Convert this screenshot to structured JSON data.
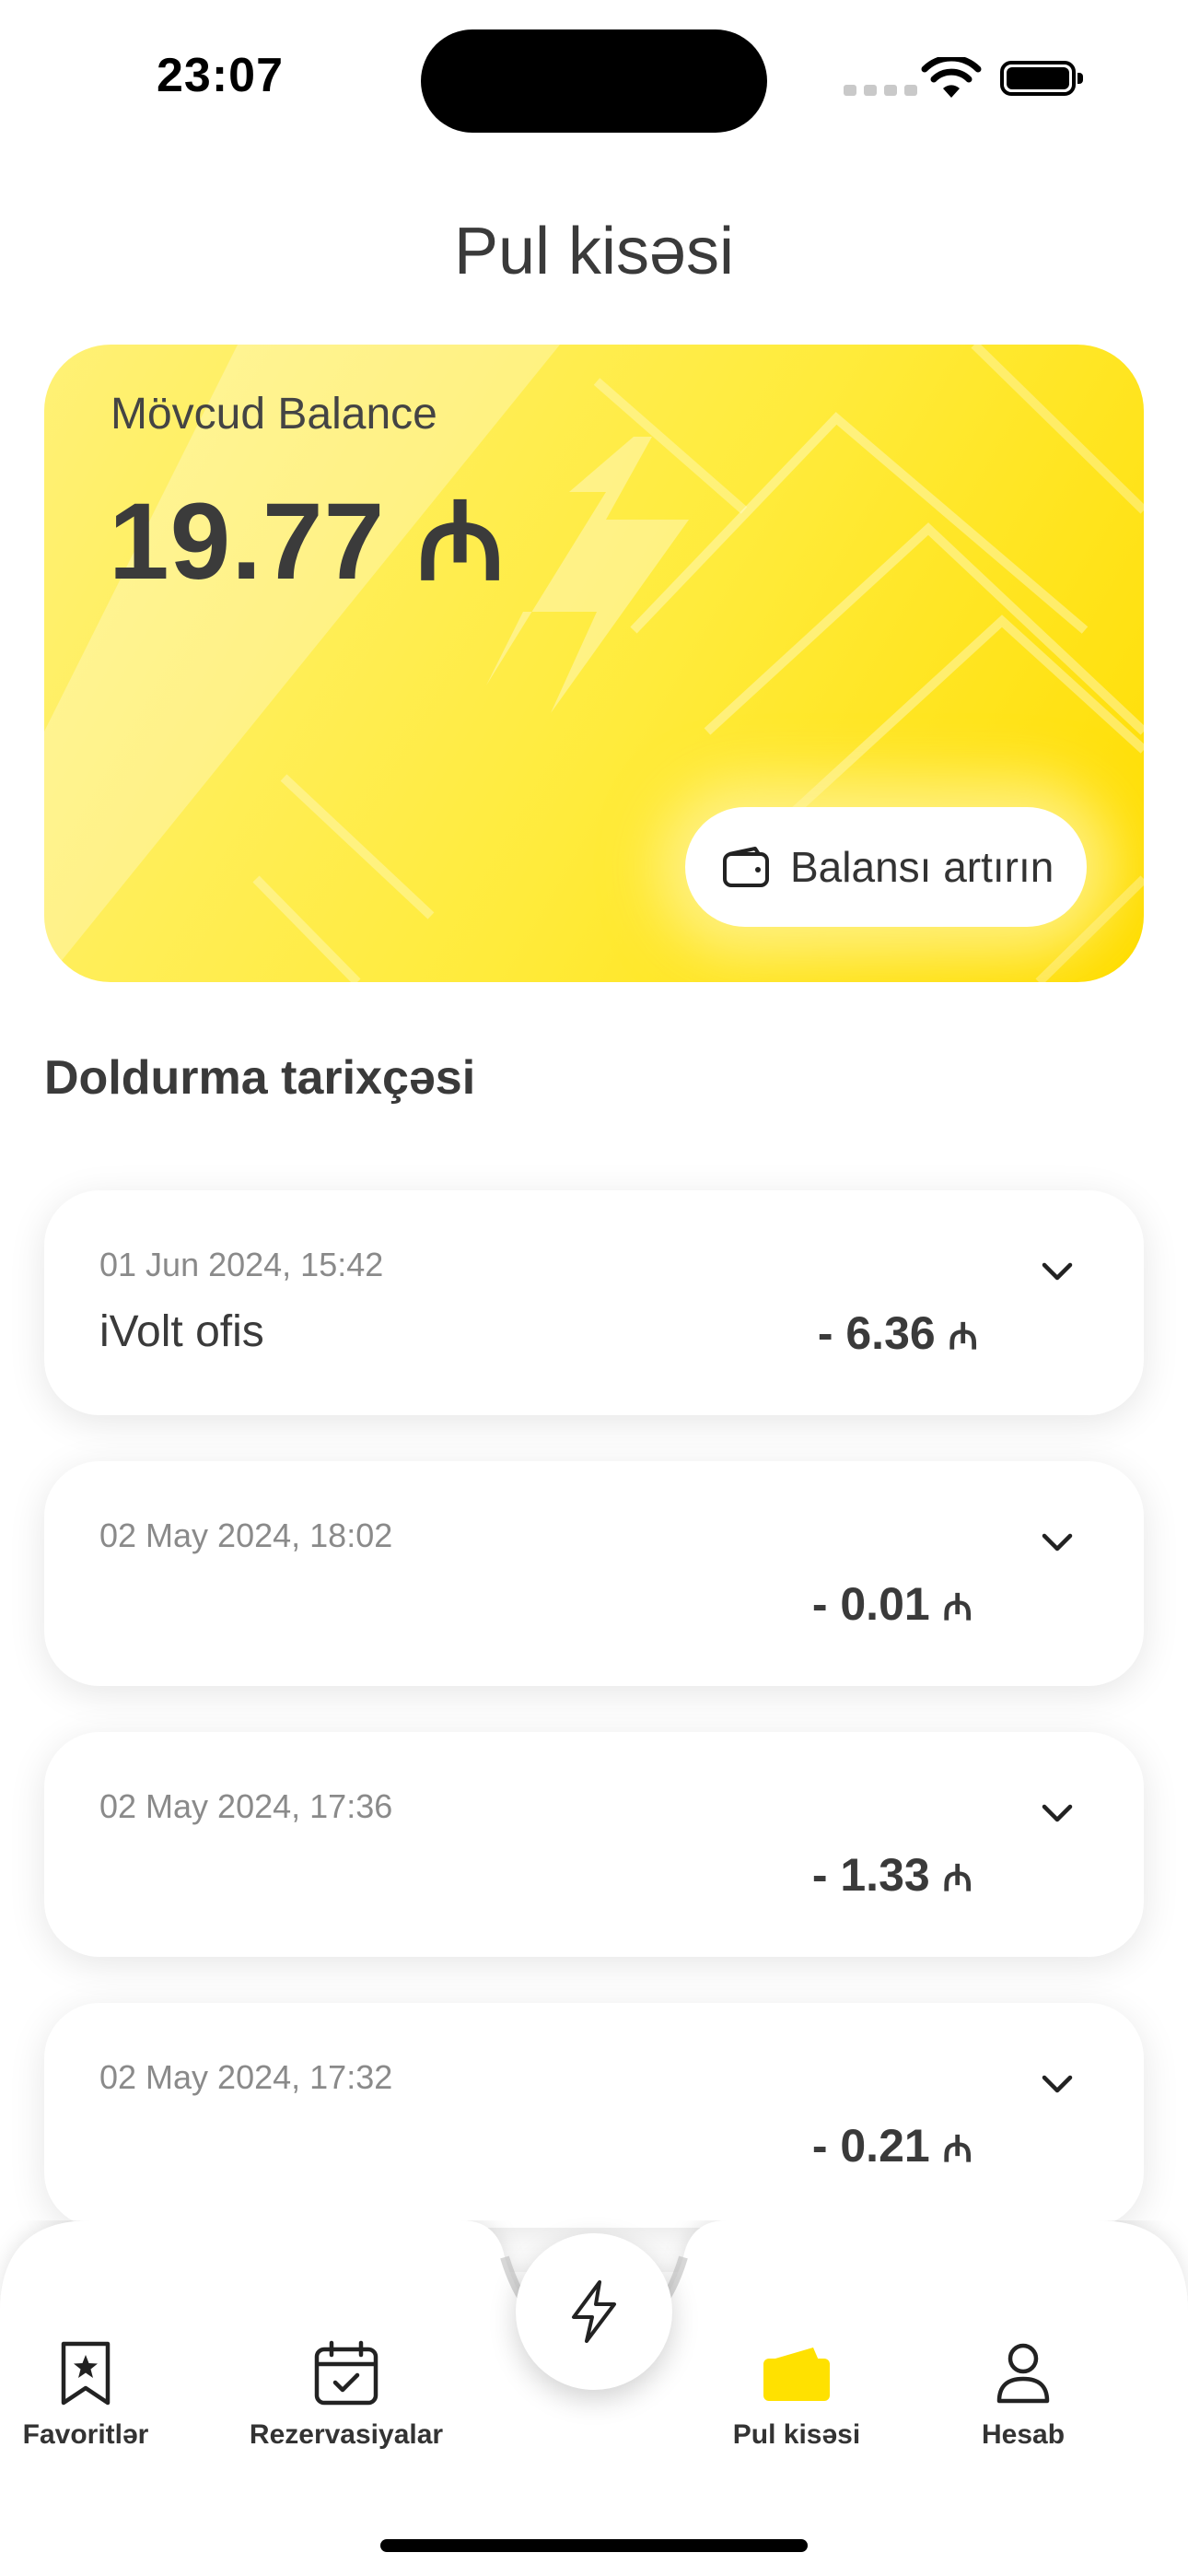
{
  "status_bar": {
    "time": "23:07"
  },
  "header": {
    "title": "Pul kisəsi"
  },
  "balance": {
    "label": "Mövcud Balance",
    "amount": "19.77 ₼",
    "topup_label": "Balansı artırın"
  },
  "history": {
    "title": "Doldurma tarixçəsi",
    "items": [
      {
        "date": "01 Jun 2024, 15:42",
        "station": "iVolt ofis",
        "amount": "- 6.36",
        "currency": "₼"
      },
      {
        "date": "02 May 2024, 18:02",
        "station": "",
        "amount": "- 0.01",
        "currency": "₼"
      },
      {
        "date": "02 May 2024, 17:36",
        "station": "",
        "amount": "- 1.33",
        "currency": "₼"
      },
      {
        "date": "02 May 2024, 17:32",
        "station": "",
        "amount": "- 0.21",
        "currency": "₼"
      }
    ]
  },
  "nav": {
    "favorites": "Favoritlər",
    "reservations": "Rezervasiyalar",
    "wallet": "Pul kisəsi",
    "account": "Hesab"
  },
  "colors": {
    "accent": "#FFE100",
    "text": "#3A3A3A",
    "muted": "#8A8A8A"
  }
}
